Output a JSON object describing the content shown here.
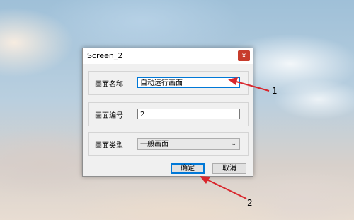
{
  "dialog": {
    "title": "Screen_2",
    "close_label": "x",
    "fields": [
      {
        "label": "画面名称",
        "value": "自动运行画面"
      },
      {
        "label": "画面编号",
        "value": "2"
      },
      {
        "label": "画面类型",
        "value": "一般画面"
      }
    ],
    "ok_label": "确定",
    "cancel_label": "取消"
  },
  "annotations": {
    "marker1": "1",
    "marker2": "2",
    "arrow_color": "#d9262c"
  }
}
